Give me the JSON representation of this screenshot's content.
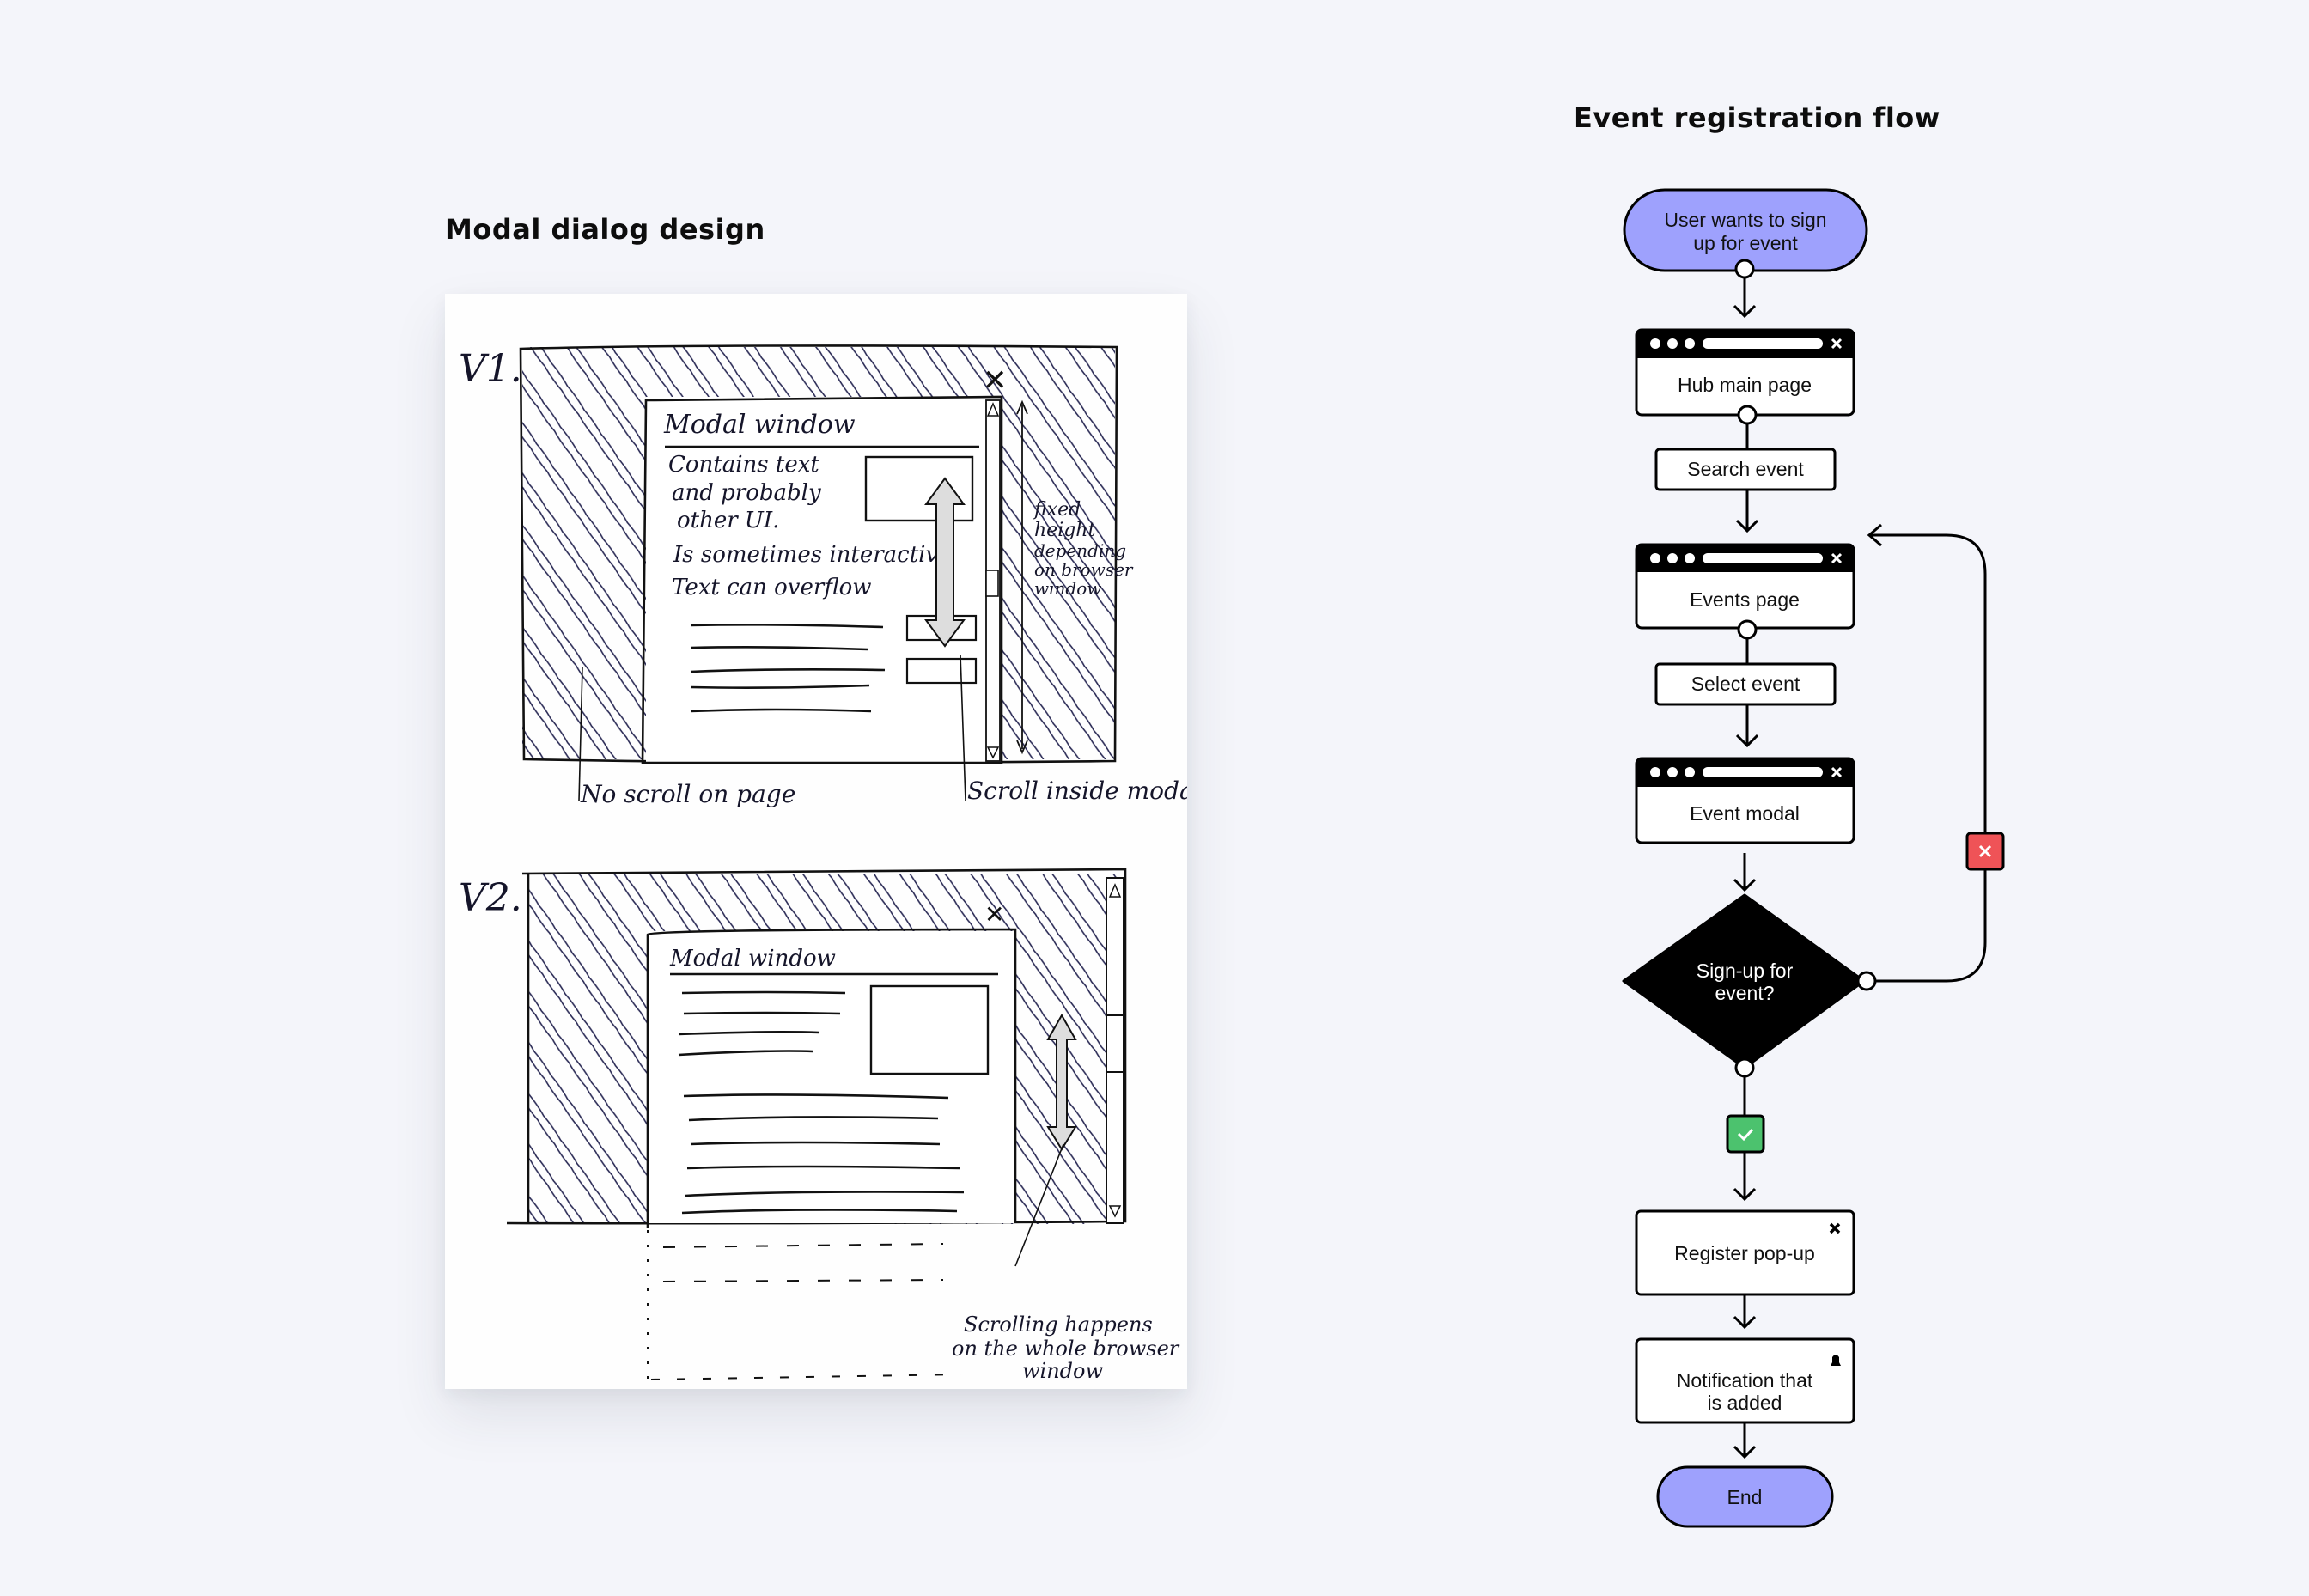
{
  "left_panel": {
    "title": "Modal dialog design",
    "sketch": {
      "v1": {
        "label": "V1.",
        "modal_title": "Modal window",
        "bullets": [
          "Contains text",
          "and probably",
          "other UI.",
          "Is sometimes interactive",
          "Text can overflow"
        ],
        "side_note": [
          "fixed",
          "height",
          "depending",
          "on browser",
          "window"
        ],
        "annotation_left": "No scroll on page",
        "annotation_right": "Scroll inside modal"
      },
      "v2": {
        "label": "V2.",
        "modal_title": "Modal window",
        "annotation": [
          "Scrolling happens",
          "on the whole browser",
          "window"
        ]
      }
    }
  },
  "right_panel": {
    "title": "Event registration flow",
    "colors": {
      "terminal": "#9ea1fd",
      "decision": "#000000",
      "yes": "#4cc26e",
      "no": "#ef5357",
      "background": "#f4f5fa"
    },
    "nodes": {
      "start": "User wants to sign up for event",
      "start_lines": [
        "User wants to sign",
        "up for event"
      ],
      "hub_main_page": "Hub main page",
      "search_event": "Search event",
      "events_page": "Events page",
      "select_event": "Select event",
      "event_modal": "Event modal",
      "decision_lines": [
        "Sign-up for",
        "event?"
      ],
      "register_popup": "Register pop-up",
      "notification_lines": [
        "Notification that",
        "is added"
      ],
      "end": "End"
    },
    "edge_labels": {
      "yes_icon": "check-icon",
      "no_icon": "close-icon"
    }
  }
}
